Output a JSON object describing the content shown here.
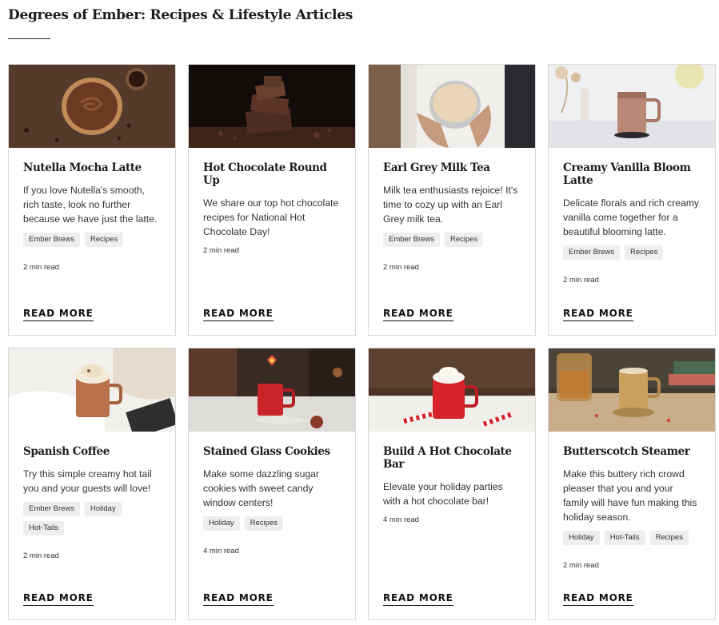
{
  "page": {
    "title": "Degrees of Ember: Recipes & Lifestyle Articles"
  },
  "articles": [
    {
      "title": "Nutella Mocha Latte",
      "excerpt": "If you love Nutella's smooth, rich taste, look no further because we have just the latte.",
      "tags": [
        "Ember Brews",
        "Recipes"
      ],
      "read_time": "2 min read",
      "cta": "READ MORE",
      "image": "chocolate-spread-in-wooden-bowl"
    },
    {
      "title": "Hot Chocolate Round Up",
      "excerpt": "We share our top hot chocolate recipes for National Hot Chocolate Day!",
      "tags": [],
      "read_time": "2 min read",
      "cta": "READ MORE",
      "image": "stacked-chocolate-pieces"
    },
    {
      "title": "Earl Grey Milk Tea",
      "excerpt": "Milk tea enthusiasts rejoice! It's time to cozy up with an Earl Grey milk tea.",
      "tags": [
        "Ember Brews",
        "Recipes"
      ],
      "read_time": "2 min read",
      "cta": "READ MORE",
      "image": "hands-holding-milk-tea-mug"
    },
    {
      "title": "Creamy Vanilla Bloom Latte",
      "excerpt": "Delicate florals and rich creamy vanilla come together for a beautiful blooming latte.",
      "tags": [
        "Ember Brews",
        "Recipes"
      ],
      "read_time": "2 min read",
      "cta": "READ MORE",
      "image": "rose-gold-ember-mug"
    },
    {
      "title": "Spanish Coffee",
      "excerpt": "Try this simple creamy hot tail you and your guests will love!",
      "tags": [
        "Ember Brews",
        "Holiday",
        "Hot-Tails"
      ],
      "read_time": "2 min read",
      "cta": "READ MORE",
      "image": "copper-mug-with-whipped-cream"
    },
    {
      "title": "Stained Glass Cookies",
      "excerpt": "Make some dazzling sugar cookies with sweet candy window centers!",
      "tags": [
        "Holiday",
        "Recipes"
      ],
      "read_time": "4 min read",
      "cta": "READ MORE",
      "image": "red-mug-with-cookies"
    },
    {
      "title": "Build A Hot Chocolate Bar",
      "excerpt": "Elevate your holiday parties with a hot chocolate bar!",
      "tags": [],
      "read_time": "4 min read",
      "cta": "READ MORE",
      "image": "red-mug-with-candy-cane"
    },
    {
      "title": "Butterscotch Steamer",
      "excerpt": "Make this buttery rich crowd pleaser that you and your family will have fun making this holiday season.",
      "tags": [
        "Holiday",
        "Hot-Tails",
        "Recipes"
      ],
      "read_time": "2 min read",
      "cta": "READ MORE",
      "image": "gold-ember-mug-with-whiskey"
    }
  ]
}
